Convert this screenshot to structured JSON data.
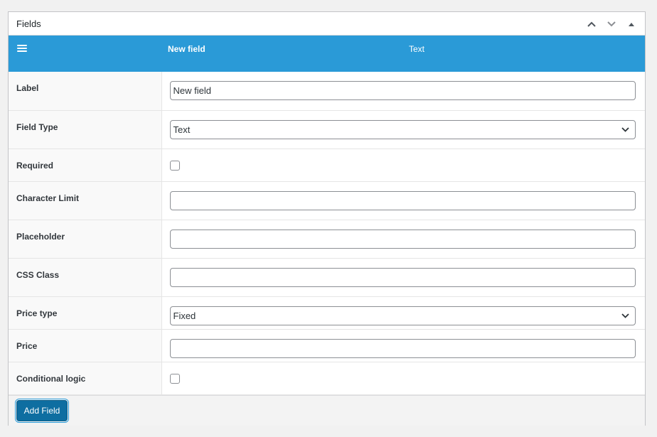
{
  "panel": {
    "title": "Fields",
    "actions": {
      "move_up": "chevron-up-icon",
      "move_down": "chevron-down-icon",
      "toggle": "triangle-up-icon"
    }
  },
  "field_bar": {
    "menu_icon": "hamburger-icon",
    "name": "New field",
    "type": "Text",
    "color": "#2a9ad7"
  },
  "rows": [
    {
      "label": "Label",
      "control": "text",
      "value": "New field"
    },
    {
      "label": "Field Type",
      "control": "select",
      "value": "Text"
    },
    {
      "label": "Required",
      "control": "checkbox",
      "checked": false
    },
    {
      "label": "Character Limit",
      "control": "text",
      "value": ""
    },
    {
      "label": "Placeholder",
      "control": "text",
      "value": ""
    },
    {
      "label": "CSS Class",
      "control": "text",
      "value": ""
    },
    {
      "label": "Price type",
      "control": "select",
      "value": "Fixed"
    },
    {
      "label": "Price",
      "control": "text",
      "value": ""
    },
    {
      "label": "Conditional logic",
      "control": "checkbox",
      "checked": false
    }
  ],
  "footer": {
    "add_field_label": "Add Field",
    "button_color": "#0e6ea1"
  }
}
